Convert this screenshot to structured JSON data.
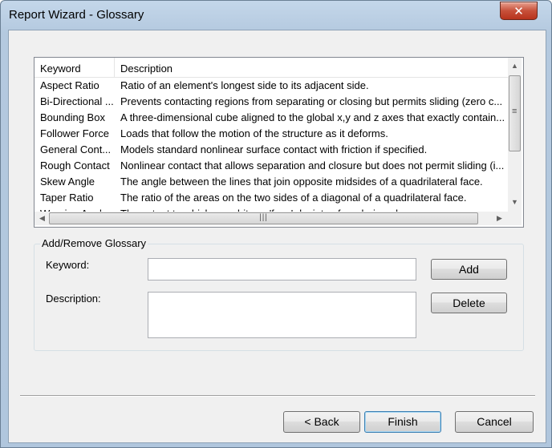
{
  "window": {
    "title": "Report Wizard - Glossary",
    "close_glyph": "✕"
  },
  "listview": {
    "columns": [
      "Keyword",
      "Description"
    ],
    "rows": [
      {
        "keyword": "Aspect Ratio",
        "description": "Ratio of an element's longest side to its adjacent side."
      },
      {
        "keyword": "Bi-Directional ...",
        "description": "Prevents contacting regions from separating or closing but permits sliding (zero c..."
      },
      {
        "keyword": "Bounding Box",
        "description": "A three-dimensional cube aligned to the global x,y and z axes that exactly contain..."
      },
      {
        "keyword": "Follower Force",
        "description": "Loads that follow the motion of the structure as it deforms."
      },
      {
        "keyword": "General Cont...",
        "description": "Models standard nonlinear surface contact with friction if specified."
      },
      {
        "keyword": "Rough Contact",
        "description": "Nonlinear contact that allows separation and closure but does not permit sliding (i..."
      },
      {
        "keyword": "Skew Angle",
        "description": "The angle between the lines that join opposite midsides of a quadrilateral face."
      },
      {
        "keyword": "Taper Ratio",
        "description": "The ratio of the areas on the two sides of a diagonal of a quadrilateral face."
      },
      {
        "keyword": "Warping Angle",
        "description": "The extent to which an arbitrary 'face' deviates from being planar."
      }
    ],
    "scroll_up": "▲",
    "scroll_down": "▼",
    "scroll_left": "◀",
    "scroll_right": "▶",
    "grip": "|||",
    "vgrip": "≡"
  },
  "glossary": {
    "group_label": "Add/Remove Glossary",
    "keyword_label": "Keyword:",
    "keyword_value": "",
    "description_label": "Description:",
    "description_value": "",
    "add_label": "Add",
    "delete_label": "Delete"
  },
  "footer": {
    "back_label": "< Back",
    "finish_label": "Finish",
    "cancel_label": "Cancel"
  }
}
